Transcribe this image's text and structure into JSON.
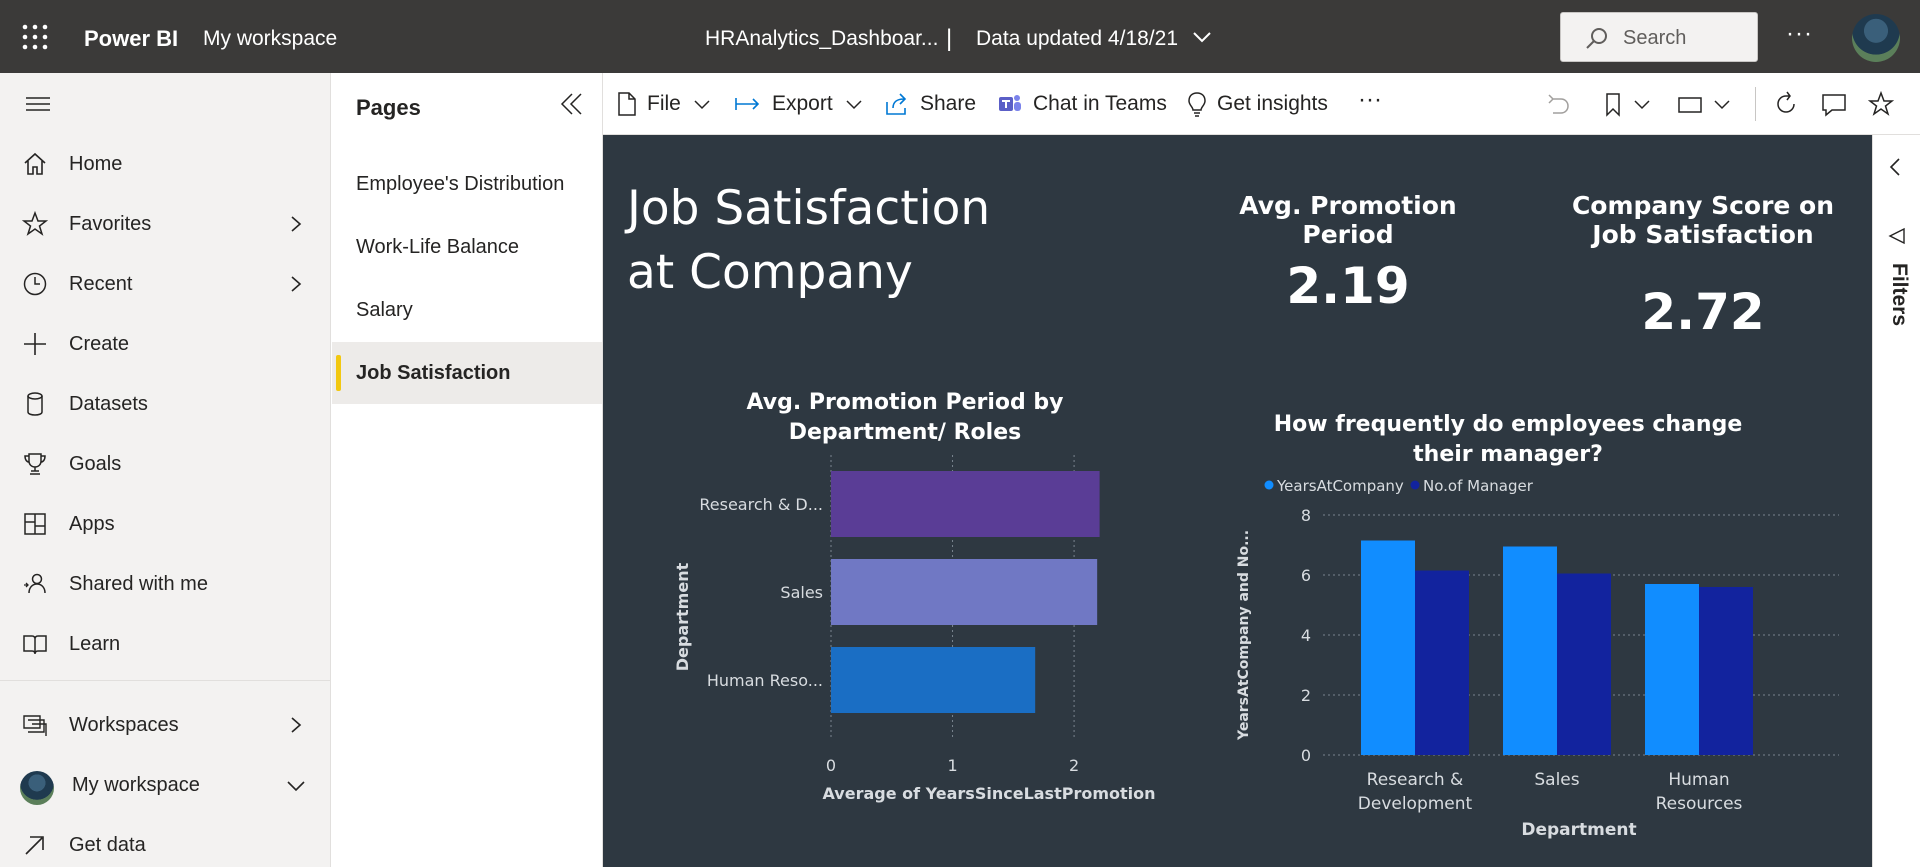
{
  "topbar": {
    "brand": "Power BI",
    "workspace": "My workspace",
    "report_name": "HRAnalytics_Dashboar...",
    "separator": "|",
    "data_updated": "Data updated 4/18/21",
    "search_placeholder": "Search",
    "more": "···"
  },
  "nav": {
    "items": [
      {
        "label": "Home",
        "icon": "home-icon"
      },
      {
        "label": "Favorites",
        "icon": "star-icon"
      },
      {
        "label": "Recent",
        "icon": "clock-icon"
      },
      {
        "label": "Create",
        "icon": "plus-icon"
      },
      {
        "label": "Datasets",
        "icon": "database-icon"
      },
      {
        "label": "Goals",
        "icon": "trophy-icon"
      },
      {
        "label": "Apps",
        "icon": "apps-icon"
      },
      {
        "label": "Shared with me",
        "icon": "shared-icon"
      },
      {
        "label": "Learn",
        "icon": "book-icon"
      }
    ],
    "workspaces": "Workspaces",
    "my_workspace": "My workspace",
    "get_data": "Get data"
  },
  "pages": {
    "title": "Pages",
    "items": [
      "Employee's Distribution",
      "Work-Life Balance",
      "Salary",
      "Job Satisfaction"
    ],
    "active": "Job Satisfaction"
  },
  "toolbar": {
    "file": "File",
    "export": "Export",
    "share": "Share",
    "chat": "Chat in Teams",
    "insights": "Get insights",
    "more": "···"
  },
  "report": {
    "title": "Job Satisfaction at Company",
    "kpi1_label": "Avg. Promotion Period",
    "kpi1_value": "2.19",
    "kpi2_label": "Company Score on Job Satisfaction",
    "kpi2_value": "2.72"
  },
  "filters": {
    "label": "Filters"
  },
  "colors": {
    "topbar": "#3b3a39",
    "canvas": "#2e3841",
    "accent": "#f2c811",
    "bar_research": "#5a3d96",
    "bar_sales": "#7078c4",
    "bar_hr": "#1a6ec4",
    "series_years": "#118dff",
    "series_manager": "#12239e"
  },
  "chart_data": [
    {
      "type": "bar",
      "orientation": "horizontal",
      "title": "Avg. Promotion Period by Department/ Roles",
      "categories": [
        "Research & D...",
        "Sales",
        "Human Reso..."
      ],
      "values": [
        2.21,
        2.19,
        1.68
      ],
      "xlabel": "Average of YearsSinceLastPromotion",
      "ylabel": "Department",
      "xticks": [
        "0",
        "1",
        "2"
      ],
      "xlim": [
        0,
        2.6
      ],
      "grid": true
    },
    {
      "type": "bar",
      "title": "How frequently do employees change their manager?",
      "categories": [
        "Research & Development",
        "Sales",
        "Human Resources"
      ],
      "series": [
        {
          "name": "YearsAtCompany",
          "values": [
            7.15,
            6.95,
            5.7
          ]
        },
        {
          "name": "No.of Manager",
          "values": [
            6.15,
            6.05,
            5.6
          ]
        }
      ],
      "xlabel": "Department",
      "ylabel": "YearsAtCompany and No...",
      "yticks": [
        "0",
        "2",
        "4",
        "6",
        "8"
      ],
      "ylim": [
        0,
        8
      ],
      "legend": "top-left",
      "grid": true
    }
  ]
}
